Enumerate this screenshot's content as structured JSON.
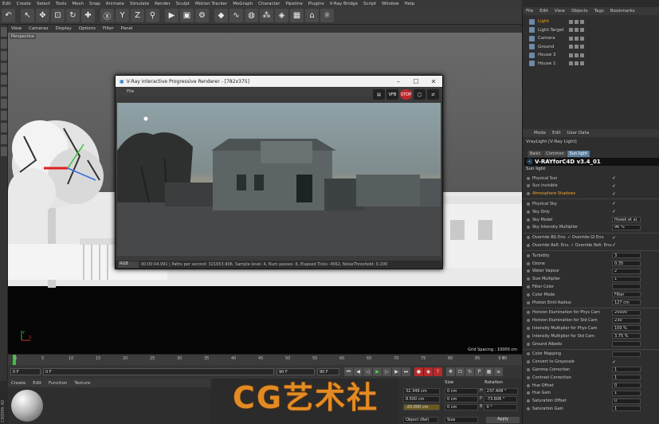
{
  "menubar": [
    "Edit",
    "Create",
    "Select",
    "Tools",
    "Mesh",
    "Snap",
    "Animate",
    "Simulate",
    "Render",
    "Sculpt",
    "Motion Tracker",
    "MoGraph",
    "Character",
    "Pipeline",
    "Plugins",
    "V-Ray Bridge",
    "Script",
    "Window",
    "Help"
  ],
  "viewport": {
    "menu": [
      "View",
      "Cameras",
      "Display",
      "Options",
      "Filter",
      "Panel"
    ],
    "label": "Perspective",
    "grid_spacing": "Grid Spacing : 10000 cm"
  },
  "vray_window": {
    "title": "V-Ray Interactive Progressive Renderer - [782x375]",
    "menu": "File",
    "tools": [
      "VFB",
      "STOP"
    ],
    "channel": "RGB",
    "status": "00:00:04.991 | Paths per second: 321653.906, Sample level: 4, Num passes: 6, Elapsed Ticks: 4562, NoiseThreshold: 0.200"
  },
  "timeline": {
    "ticks": [
      "0",
      "5",
      "10",
      "15",
      "20",
      "25",
      "30",
      "35",
      "40",
      "45",
      "50",
      "55",
      "60",
      "65",
      "70",
      "75",
      "80",
      "85",
      "90"
    ],
    "end_label": "0 F"
  },
  "playbar": {
    "start": "0 F",
    "current": "0 F",
    "end": "90 F",
    "end2": "90 F"
  },
  "material_manager": {
    "menu": [
      "Create",
      "Edit",
      "Function",
      "Texture"
    ],
    "side_label": "CINEMA 4D"
  },
  "coordinates": {
    "headers": [
      "Size",
      "Rotation"
    ],
    "rows": [
      {
        "pos": "32.349 cm",
        "size": "0 cm",
        "rot_label": "H",
        "rot": "237.408 °"
      },
      {
        "pos": "8.500 cm",
        "size": "0 cm",
        "rot_label": "P",
        "rot": "-73.606 °"
      },
      {
        "pos": "-20.000 cm",
        "size": "0 cm",
        "rot_label": "B",
        "rot": "0 °"
      }
    ],
    "mode": "Object (Rel)",
    "size_mode": "Size",
    "apply": "Apply"
  },
  "watermark": "CG艺术社",
  "object_manager": {
    "menu": [
      "File",
      "Edit",
      "View",
      "Objects",
      "Tags",
      "Bookmarks"
    ],
    "items": [
      {
        "name": "Light",
        "selected": true
      },
      {
        "name": "Light.Target",
        "selected": false
      },
      {
        "name": "Camera",
        "selected": false
      },
      {
        "name": "Ground",
        "selected": false
      },
      {
        "name": "House 3",
        "selected": false
      },
      {
        "name": "House 1",
        "selected": false
      }
    ]
  },
  "attribute_manager": {
    "menu": [
      "Mode",
      "Edit",
      "User Data"
    ],
    "object": "VrayLight [V-Ray Light]",
    "tabs": [
      "Basic",
      "Common",
      "Sun light"
    ],
    "active_tab": "Sun light",
    "logo": "V-RAYforC4D v3.4_01",
    "section": "Sun light",
    "props": [
      {
        "label": "Physical Sun",
        "value": "✓"
      },
      {
        "label": "Sun Invisible",
        "value": "✓"
      },
      {
        "label": "Atmosphere Shadows",
        "value": "✓",
        "highlight": true
      },
      {
        "label": "Physical Sky",
        "value": "✓"
      },
      {
        "label": "Sky Only",
        "value": "✓"
      },
      {
        "label": "Sky Model",
        "value": "Hosek et al."
      },
      {
        "label": "Sky Intensity Multiplier",
        "value": "96 %"
      },
      {
        "label": "Override BG Env.  ✓   Override GI Env.",
        "value": "✓"
      },
      {
        "label": "Override Refl. Env. ✓   Override Refr. Env.",
        "value": "✓"
      },
      {
        "label": "Turbidity",
        "value": "3"
      },
      {
        "label": "Ozone",
        "value": "0.35"
      },
      {
        "label": "Water Vapour",
        "value": "2"
      },
      {
        "label": "Size Multiplier",
        "value": "1"
      },
      {
        "label": "Filter Color",
        "value": ""
      },
      {
        "label": "Color Mode",
        "value": "Filter"
      },
      {
        "label": "Photon Emit Radius",
        "value": "127 cm"
      },
      {
        "label": "Horizon Illumination for Phys Cam",
        "value": "25000"
      },
      {
        "label": "Horizon Illumination for Std Cam",
        "value": "230"
      },
      {
        "label": "Intensity Multiplier for Phys Cam",
        "value": "100 %"
      },
      {
        "label": "Intensity Multiplier for Std Cam",
        "value": "3.75 %"
      },
      {
        "label": "Ground Albedo",
        "value": ""
      },
      {
        "label": "Color Mapping",
        "value": ""
      },
      {
        "label": "Convert to Grayscale",
        "value": "✓"
      },
      {
        "label": "Gamma Correction",
        "value": "1"
      },
      {
        "label": "Contrast Correction",
        "value": "1"
      },
      {
        "label": "Hue Offset",
        "value": "0"
      },
      {
        "label": "Hue Gain",
        "value": "1"
      },
      {
        "label": "Saturation Offset",
        "value": "0"
      },
      {
        "label": "Saturation Gain",
        "value": "1"
      }
    ]
  },
  "colors": {
    "accent_orange": "#f7a21b",
    "selection_blue": "#5d7fa0",
    "stop_red": "#c0272d"
  }
}
